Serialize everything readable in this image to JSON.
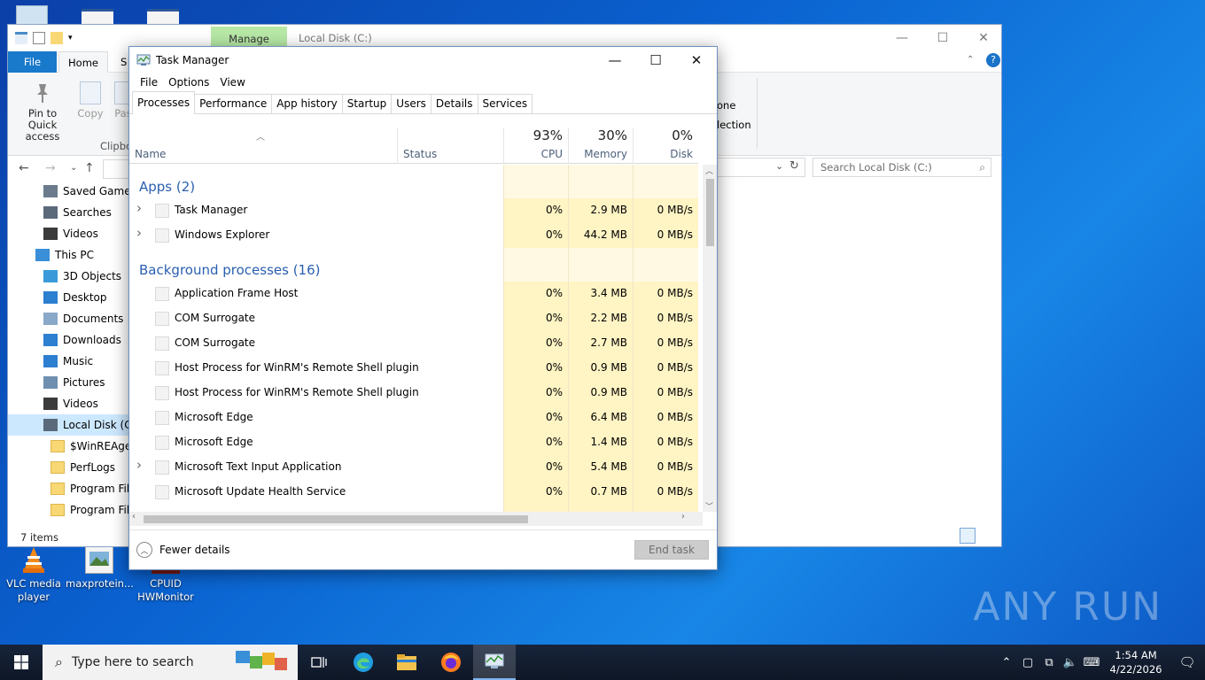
{
  "desktop": {
    "icons": [
      {
        "label": "VLC media player",
        "name": "vlc"
      },
      {
        "label": "maxprotein...",
        "name": "maxprotein"
      },
      {
        "label": "CPUID HWMonitor",
        "name": "hwmonitor"
      }
    ],
    "watermark": "ANY RUN"
  },
  "explorer": {
    "manage_tab": "Manage",
    "title": "Local Disk (C:)",
    "tabs": {
      "file": "File",
      "home": "Home",
      "share": "S"
    },
    "ribbon": {
      "pin": "Pin to Quick access",
      "copy": "Copy",
      "paste": "Pas",
      "clipboard": "Clipbo",
      "right_text_1": "one",
      "right_text_2": "lection"
    },
    "search_placeholder": "Search Local Disk (C:)",
    "tree": [
      {
        "label": "Saved Games",
        "icon": "saved-games-icon"
      },
      {
        "label": "Searches",
        "icon": "search-icon"
      },
      {
        "label": "Videos",
        "icon": "videos-icon"
      },
      {
        "label": "This PC",
        "icon": "pc-icon"
      },
      {
        "label": "3D Objects",
        "icon": "objects-3d-icon"
      },
      {
        "label": "Desktop",
        "icon": "desktop-icon"
      },
      {
        "label": "Documents",
        "icon": "documents-icon"
      },
      {
        "label": "Downloads",
        "icon": "downloads-icon"
      },
      {
        "label": "Music",
        "icon": "music-icon"
      },
      {
        "label": "Pictures",
        "icon": "pictures-icon"
      },
      {
        "label": "Videos",
        "icon": "videos-icon"
      },
      {
        "label": "Local Disk (C:)",
        "icon": "drive-icon"
      },
      {
        "label": "$WinREAgen",
        "icon": "folder-icon"
      },
      {
        "label": "PerfLogs",
        "icon": "folder-icon"
      },
      {
        "label": "Program File",
        "icon": "folder-icon"
      },
      {
        "label": "Program File",
        "icon": "folder-icon"
      }
    ],
    "status": "7 items"
  },
  "taskmgr": {
    "title": "Task Manager",
    "menu": [
      "File",
      "Options",
      "View"
    ],
    "tabs": [
      "Processes",
      "Performance",
      "App history",
      "Startup",
      "Users",
      "Details",
      "Services"
    ],
    "active_tab": "Processes",
    "columns": {
      "name": "Name",
      "status": "Status",
      "cpu_pct": "93%",
      "cpu": "CPU",
      "mem_pct": "30%",
      "mem": "Memory",
      "disk_pct": "0%",
      "disk": "Disk"
    },
    "groups": {
      "apps": "Apps (2)",
      "background": "Background processes (16)"
    },
    "apps": [
      {
        "name": "Task Manager",
        "cpu": "0%",
        "mem": "2.9 MB",
        "disk": "0 MB/s",
        "expandable": true
      },
      {
        "name": "Windows Explorer",
        "cpu": "0%",
        "mem": "44.2 MB",
        "disk": "0 MB/s",
        "expandable": true
      }
    ],
    "background": [
      {
        "name": "Application Frame Host",
        "cpu": "0%",
        "mem": "3.4 MB",
        "disk": "0 MB/s",
        "expandable": false
      },
      {
        "name": "COM Surrogate",
        "cpu": "0%",
        "mem": "2.2 MB",
        "disk": "0 MB/s",
        "expandable": false
      },
      {
        "name": "COM Surrogate",
        "cpu": "0%",
        "mem": "2.7 MB",
        "disk": "0 MB/s",
        "expandable": false
      },
      {
        "name": "Host Process for WinRM's Remote Shell plugin",
        "cpu": "0%",
        "mem": "0.9 MB",
        "disk": "0 MB/s",
        "expandable": false
      },
      {
        "name": "Host Process for WinRM's Remote Shell plugin",
        "cpu": "0%",
        "mem": "0.9 MB",
        "disk": "0 MB/s",
        "expandable": false
      },
      {
        "name": "Microsoft Edge",
        "cpu": "0%",
        "mem": "6.4 MB",
        "disk": "0 MB/s",
        "expandable": false
      },
      {
        "name": "Microsoft Edge",
        "cpu": "0%",
        "mem": "1.4 MB",
        "disk": "0 MB/s",
        "expandable": false
      },
      {
        "name": "Microsoft Text Input Application",
        "cpu": "0%",
        "mem": "5.4 MB",
        "disk": "0 MB/s",
        "expandable": true
      },
      {
        "name": "Microsoft Update Health Service",
        "cpu": "0%",
        "mem": "0.7 MB",
        "disk": "0 MB/s",
        "expandable": false
      }
    ],
    "fewer_details": "Fewer details",
    "end_task": "End task"
  },
  "taskbar": {
    "search_placeholder": "Type here to search",
    "time": "1:54 AM",
    "date": "4/22/2026"
  },
  "colors": {
    "accent": "#1979ca",
    "group_heading": "#2a5fb0",
    "cpu_heat": "#fff4c4",
    "heat_light": "#fff9e3"
  }
}
